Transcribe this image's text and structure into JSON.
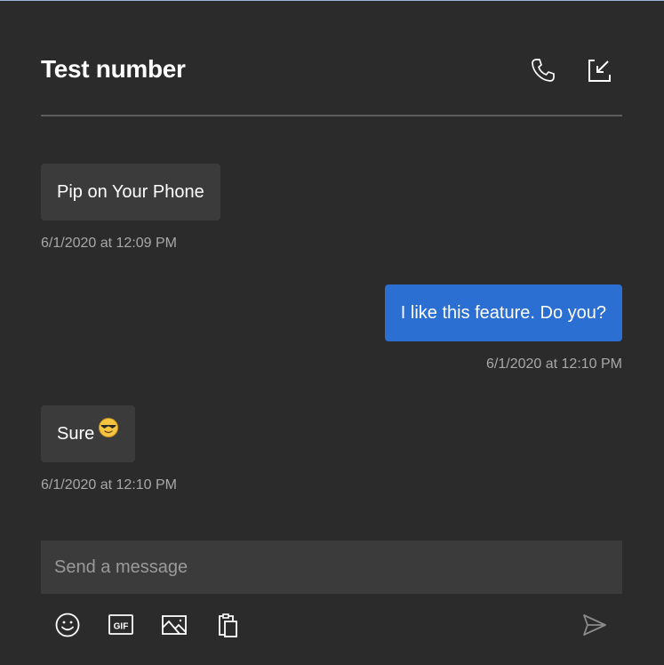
{
  "header": {
    "title": "Test number",
    "call_icon": "phone-icon",
    "popin_icon": "pop-in-arrow-icon"
  },
  "messages": [
    {
      "direction": "received",
      "text": "Pip on Your Phone",
      "timestamp": "6/1/2020 at 12:09 PM"
    },
    {
      "direction": "sent",
      "text": "I like this feature. Do you?",
      "timestamp": "6/1/2020 at 12:10 PM"
    },
    {
      "direction": "received",
      "text": "Sure",
      "emoji": "smiling-face-with-sunglasses",
      "timestamp": "6/1/2020 at 12:10 PM"
    }
  ],
  "composer": {
    "placeholder": "Send a message",
    "value": ""
  },
  "toolbar": {
    "emoji_icon": "emoji-icon",
    "gif_label": "GIF",
    "image_icon": "image-icon",
    "clipboard_icon": "clipboard-icon",
    "send_icon": "send-icon"
  },
  "colors": {
    "background": "#2b2b2b",
    "received_bubble": "#3b3b3b",
    "sent_bubble": "#2b6fd2",
    "timestamp": "#a8a8a8",
    "divider": "#5c5c5c",
    "send_disabled": "#8a8a8a"
  }
}
